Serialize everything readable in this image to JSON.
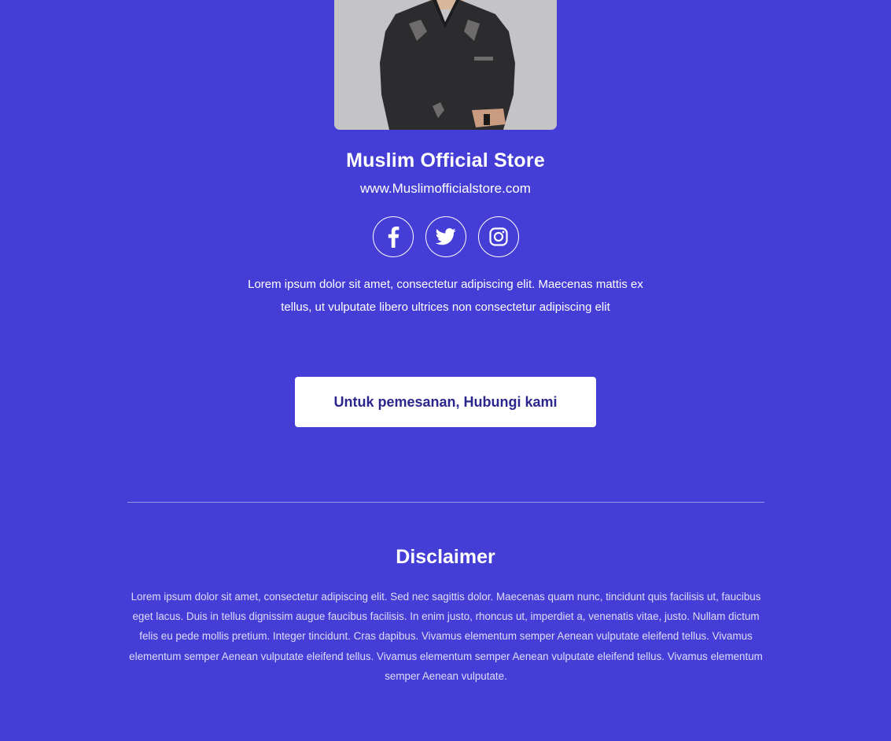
{
  "profile": {
    "name": "Muslim Official Store",
    "website": "www.Muslimofficialstore.com",
    "bio": "Lorem ipsum dolor sit amet, consectetur adipiscing elit. Maecenas mattis ex tellus, ut vulputate libero ultrices non consectetur adipiscing elit"
  },
  "social": [
    {
      "icon": "facebook-icon"
    },
    {
      "icon": "twitter-icon"
    },
    {
      "icon": "instagram-icon"
    }
  ],
  "cta": {
    "label": "Untuk pemesanan, Hubungi kami"
  },
  "disclaimer": {
    "title": "Disclaimer",
    "text": "Lorem ipsum dolor sit amet, consectetur adipiscing elit. Sed nec sagittis dolor. Maecenas quam nunc, tincidunt quis facilisis ut, faucibus eget lacus. Duis in tellus dignissim augue faucibus facilisis. In enim justo, rhoncus ut, imperdiet a, venenatis vitae, justo. Nullam dictum felis eu pede mollis pretium. Integer tincidunt. Cras dapibus. Vivamus elementum semper Aenean vulputate eleifend tellus. Vivamus elementum semper Aenean vulputate eleifend tellus. Vivamus elementum semper Aenean vulputate eleifend tellus. Vivamus elementum semper Aenean vulputate."
  },
  "colors": {
    "background": "#443dd6",
    "button_text": "#2b268c",
    "photo_bg": "#c4c3c5"
  }
}
